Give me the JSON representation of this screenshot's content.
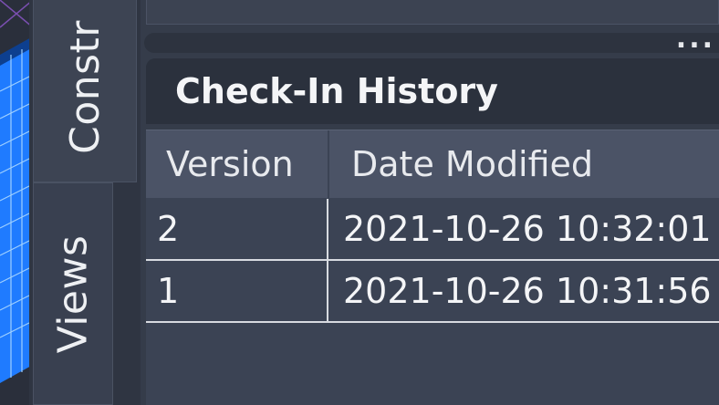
{
  "colors": {
    "background": "#3b4354",
    "header_dark": "#2b313d",
    "table_header": "#4b5366",
    "viewport_blue": "#1f7bff"
  },
  "side_tabs": [
    {
      "label": "Constr"
    },
    {
      "label": "Views"
    }
  ],
  "palette": {
    "overflow_icon": "ellipsis-icon",
    "overflow_label": "...",
    "section_title": "Check-In History"
  },
  "table": {
    "columns": [
      "Version",
      "Date Modified"
    ],
    "rows": [
      {
        "version": "2",
        "date_modified": "2021-10-26 10:32:01"
      },
      {
        "version": "1",
        "date_modified": "2021-10-26 10:31:56"
      }
    ]
  }
}
